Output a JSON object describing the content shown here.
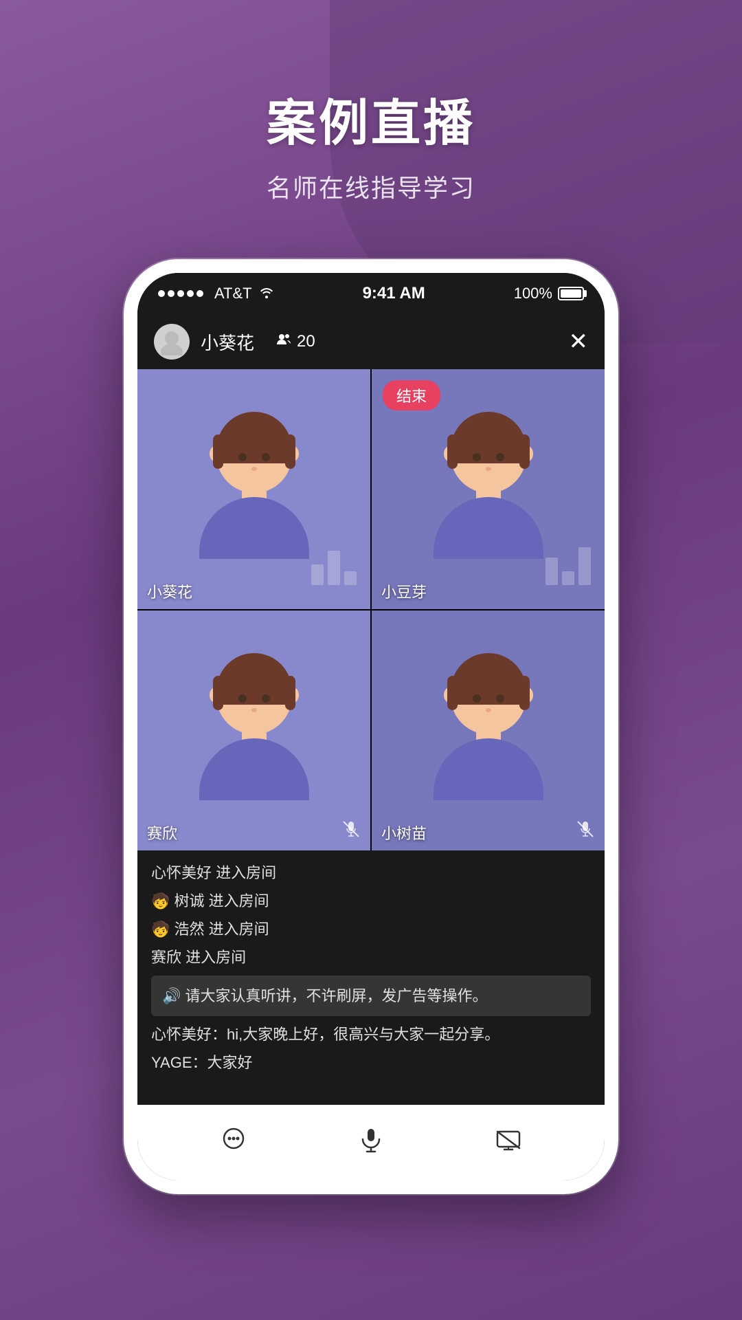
{
  "background": {
    "color": "#7b4a8e"
  },
  "header": {
    "title": "案例直播",
    "subtitle": "名师在线指导学习"
  },
  "statusBar": {
    "carrier": "AT&T",
    "signal": "●●●●●",
    "time": "9:41 AM",
    "battery": "100%"
  },
  "appHeader": {
    "username": "小葵花",
    "viewerCount": "20",
    "closeLabel": "✕"
  },
  "videoGrid": {
    "cells": [
      {
        "name": "小葵花",
        "hasMute": false,
        "hasEndBadge": false,
        "cellClass": "video-cell-1"
      },
      {
        "name": "小豆芽",
        "hasMute": false,
        "hasEndBadge": true,
        "cellClass": "video-cell-2"
      },
      {
        "name": "赛欣",
        "hasMute": true,
        "hasEndBadge": false,
        "cellClass": "video-cell-3"
      },
      {
        "name": "小树苗",
        "hasMute": true,
        "hasEndBadge": false,
        "cellClass": "video-cell-4"
      }
    ],
    "endBadgeLabel": "结束"
  },
  "chat": {
    "messages": [
      {
        "type": "system",
        "text": "心怀美好 进入房间"
      },
      {
        "type": "system",
        "emoji": "🧒",
        "text": "树诚 进入房间"
      },
      {
        "type": "system",
        "emoji": "🧒",
        "text": "浩然 进入房间"
      },
      {
        "type": "system",
        "text": "赛欣 进入房间"
      },
      {
        "type": "notice",
        "text": "🔊 请大家认真听讲，不许刷屏，发广告等操作。"
      },
      {
        "type": "user",
        "user": "心怀美好",
        "text": "hi,大家晚上好，很高兴与大家一起分享。"
      },
      {
        "type": "user",
        "user": "YAGE",
        "text": "大家好"
      }
    ]
  },
  "toolbar": {
    "chatIcon": "💬",
    "micIcon": "mic",
    "screenIcon": "screen-off"
  }
}
